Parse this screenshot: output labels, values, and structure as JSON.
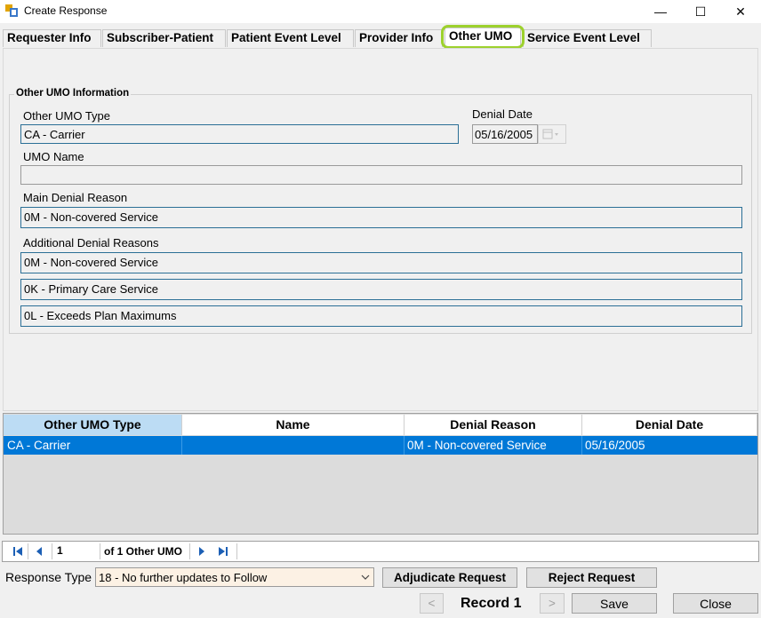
{
  "window": {
    "title": "Create Response",
    "minimize_glyph": "—",
    "maximize_glyph": "☐",
    "close_glyph": "✕"
  },
  "tabs": [
    {
      "label": "Requester Info"
    },
    {
      "label": "Subscriber-Patient"
    },
    {
      "label": "Patient Event Level"
    },
    {
      "label": "Provider Info"
    },
    {
      "label": "Other UMO"
    },
    {
      "label": "Service Event Level"
    }
  ],
  "active_tab": "Other UMO",
  "form": {
    "group_title": "Other UMO Information",
    "other_umo_type_label": "Other UMO Type",
    "other_umo_type_value": "CA - Carrier",
    "denial_date_label": "Denial Date",
    "denial_date_value": "05/16/2005",
    "umo_name_label": "UMO Name",
    "umo_name_value": "",
    "main_denial_reason_label": "Main Denial Reason",
    "main_denial_reason_value": "0M - Non-covered Service",
    "additional_denial_reasons_label": "Additional Denial Reasons",
    "additional_denial_reasons": [
      "0M - Non-covered Service",
      "0K - Primary Care Service",
      "0L - Exceeds Plan Maximums"
    ]
  },
  "grid": {
    "columns": [
      "Other UMO Type",
      "Name",
      "Denial Reason",
      "Denial Date"
    ],
    "rows": [
      {
        "other_umo_type": "CA - Carrier",
        "name": "",
        "denial_reason": "0M - Non-covered Service",
        "denial_date": "05/16/2005"
      }
    ]
  },
  "navigator": {
    "position": "1",
    "count_text": "of 1 Other UMO"
  },
  "footer": {
    "response_type_label": "Response Type",
    "response_type_value": "18 - No further updates to Follow",
    "adjudicate_label": "Adjudicate Request",
    "reject_label": "Reject Request",
    "prev_glyph": "<",
    "next_glyph": ">",
    "record_label": "Record 1",
    "save_label": "Save",
    "close_label": "Close"
  },
  "colors": {
    "selection": "#0078d7",
    "tab_highlight": "#9dd12d",
    "field_border": "#2b6f96",
    "response_bg": "#fcf1e4"
  }
}
